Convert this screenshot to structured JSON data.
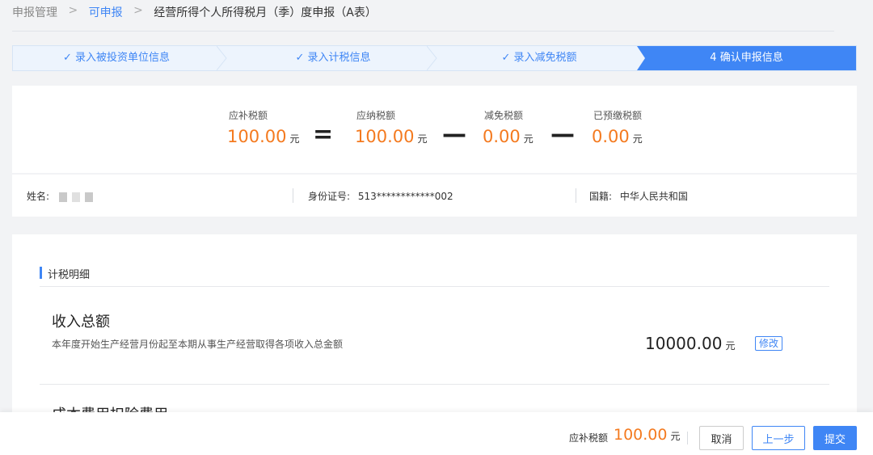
{
  "breadcrumb": {
    "root": "申报管理",
    "link": "可申报",
    "current": "经营所得个人所得税月（季）度申报（A表）",
    "separator": ">"
  },
  "steps": [
    {
      "label": "录入被投资单位信息",
      "done": true
    },
    {
      "label": "录入计税信息",
      "done": true
    },
    {
      "label": "录入减免税额",
      "done": true
    },
    {
      "label": "4 确认申报信息",
      "done": false,
      "active": true
    }
  ],
  "check_glyph": "✓",
  "summary": {
    "payable": {
      "label": "应补税额",
      "value": "100.00",
      "unit": "元"
    },
    "equals": "=",
    "due": {
      "label": "应纳税额",
      "value": "100.00",
      "unit": "元"
    },
    "minus1": "—",
    "relief": {
      "label": "减免税额",
      "value": "0.00",
      "unit": "元"
    },
    "minus2": "—",
    "prepaid": {
      "label": "已预缴税额",
      "value": "0.00",
      "unit": "元"
    }
  },
  "person": {
    "name_label": "姓名:",
    "id_label": "身份证号:",
    "id_value": "513************002",
    "nation_label": "国籍:",
    "nation_value": "中华人民共和国"
  },
  "detail": {
    "section_title": "计税明细",
    "income_title": "收入总额",
    "income_desc": "本年度开始生产经营月份起至本期从事生产经营取得各项收入总金额",
    "income_amount": "10000.00",
    "income_unit": "元",
    "edit_label": "修改",
    "next_title_partial": "成本费用扣除费用"
  },
  "footer": {
    "payable_label": "应补税额",
    "payable_value": "100.00",
    "payable_unit": "元",
    "cancel_label": "取消",
    "prev_label": "上一步",
    "submit_label": "提交"
  },
  "colors": {
    "accent": "#3f86f5",
    "amount": "#f47a1f"
  }
}
